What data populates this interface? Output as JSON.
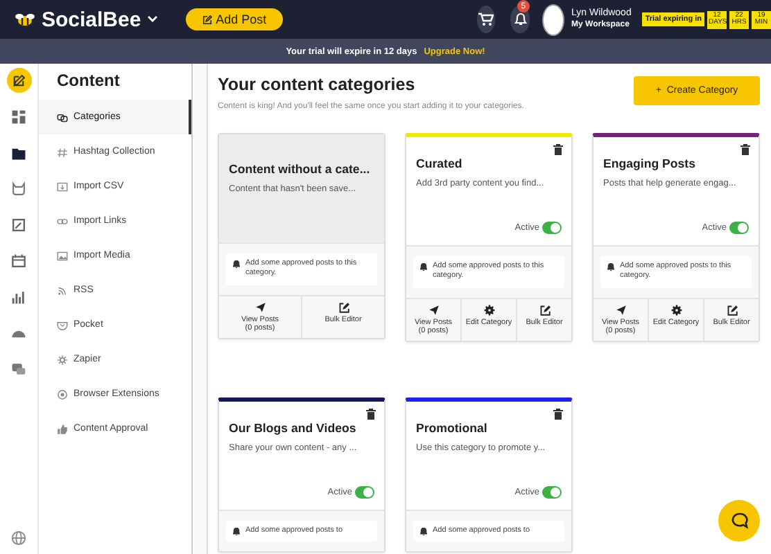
{
  "header": {
    "logo": "SocialBee",
    "add_post": "Add Post",
    "notifications": "5",
    "user_name": "Lyn Wildwood",
    "workspace": "My Workspace",
    "trial_label": "Trial expiring in",
    "countdown": [
      {
        "value": "12",
        "unit": "DAYS"
      },
      {
        "value": "22",
        "unit": "HRS"
      },
      {
        "value": "19",
        "unit": "MIN"
      }
    ]
  },
  "banner": {
    "text": "Your trial will expire in 12 days",
    "link": "Upgrade Now!"
  },
  "rail": {
    "items": [
      {
        "selected": true
      },
      {
        "selected": false
      },
      {
        "selected": false
      },
      {
        "selected": false
      },
      {
        "selected": false
      },
      {
        "selected": false
      },
      {
        "selected": false
      },
      {
        "selected": false
      },
      {
        "selected": false
      }
    ]
  },
  "sidebar": {
    "title": "Content",
    "items": [
      {
        "label": "Categories",
        "selected": true
      },
      {
        "label": "Hashtag Collection",
        "selected": false
      },
      {
        "label": "Import CSV",
        "selected": false
      },
      {
        "label": "Import Links",
        "selected": false
      },
      {
        "label": "Import Media",
        "selected": false
      },
      {
        "label": "RSS",
        "selected": false
      },
      {
        "label": "Pocket",
        "selected": false
      },
      {
        "label": "Zapier",
        "selected": false
      },
      {
        "label": "Browser Extensions",
        "selected": false
      },
      {
        "label": "Content Approval",
        "selected": false
      }
    ]
  },
  "main": {
    "title": "Your content categories",
    "subtitle": "Content is king! And you'll feel the same once you start adding it to your categories.",
    "create_button_icon": "+",
    "create_button": "Create Category",
    "cards": [
      {
        "kind": "uncategorized",
        "title": "Content without a cate...",
        "description": "Content that hasn't been save...",
        "notice": "Add some approved posts to this category.",
        "actions": [
          {
            "kind": "view",
            "label": "View Posts",
            "count": "(0 posts)"
          },
          {
            "kind": "bulk",
            "label": "Bulk Editor"
          }
        ]
      },
      {
        "kind": "category",
        "color": "#f2ea00",
        "title": "Curated",
        "description": "Add 3rd party content you find...",
        "status": "Active",
        "active": true,
        "notice": "Add some approved posts to this category.",
        "actions": [
          {
            "kind": "view",
            "label": "View Posts",
            "count": "(0 posts)"
          },
          {
            "kind": "edit",
            "label": "Edit Category"
          },
          {
            "kind": "bulk",
            "label": "Bulk Editor"
          }
        ]
      },
      {
        "kind": "category",
        "color": "#7a1f7e",
        "title": "Engaging Posts",
        "description": "Posts that help generate engag...",
        "status": "Active",
        "active": true,
        "notice": "Add some approved posts to this category.",
        "actions": [
          {
            "kind": "view",
            "label": "View Posts",
            "count": "(0 posts)"
          },
          {
            "kind": "edit",
            "label": "Edit Category"
          },
          {
            "kind": "bulk",
            "label": "Bulk Editor"
          }
        ]
      },
      {
        "kind": "category",
        "color": "#15155e",
        "title": "Our Blogs and Videos",
        "description": "Share your own content - any ...",
        "status": "Active",
        "active": true,
        "notice": "Add some approved posts to"
      },
      {
        "kind": "category",
        "color": "#1f1fee",
        "title": "Promotional",
        "description": "Use this category to promote y...",
        "status": "Active",
        "active": true,
        "notice": "Add some approved posts to"
      }
    ]
  }
}
